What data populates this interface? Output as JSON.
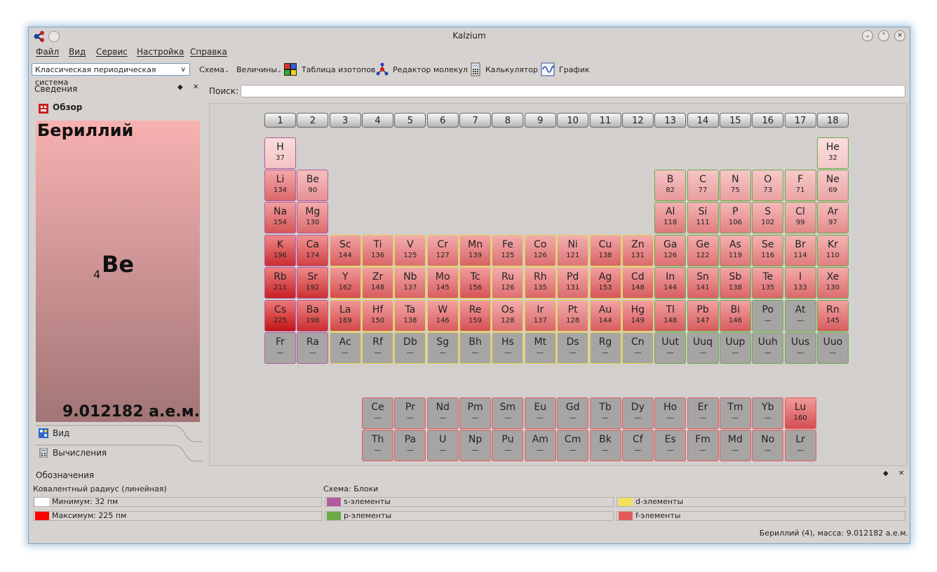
{
  "window": {
    "title": "Kalzium"
  },
  "menu": [
    "Файл",
    "Вид",
    "Сервис",
    "Настройка",
    "Справка"
  ],
  "toolbar": {
    "scheme_select": "Классическая периодическая система",
    "scheme": "Схема",
    "values": "Величины",
    "isotopes": "Таблица изотопов",
    "molecule_editor": "Редактор молекул",
    "calculator": "Калькулятор",
    "plot": "График"
  },
  "info_panel": {
    "title": "Сведения",
    "overview": "Обзор",
    "element_name": "Бериллий",
    "element_number": "4",
    "element_symbol": "Be",
    "element_mass": "9.012182 а.е.м.",
    "tabs": [
      "Вид",
      "Вычисления"
    ]
  },
  "search": {
    "label": "Поиск:",
    "value": ""
  },
  "groups": [
    "1",
    "2",
    "3",
    "4",
    "5",
    "6",
    "7",
    "8",
    "9",
    "10",
    "11",
    "12",
    "13",
    "14",
    "15",
    "16",
    "17",
    "18"
  ],
  "elements": [
    {
      "s": "H",
      "r": "37",
      "row": 0,
      "col": 0,
      "b": "s"
    },
    {
      "s": "He",
      "r": "32",
      "row": 0,
      "col": 17,
      "b": "p"
    },
    {
      "s": "Li",
      "r": "134",
      "row": 1,
      "col": 0,
      "b": "s"
    },
    {
      "s": "Be",
      "r": "90",
      "row": 1,
      "col": 1,
      "b": "s"
    },
    {
      "s": "B",
      "r": "82",
      "row": 1,
      "col": 12,
      "b": "p"
    },
    {
      "s": "C",
      "r": "77",
      "row": 1,
      "col": 13,
      "b": "p"
    },
    {
      "s": "N",
      "r": "75",
      "row": 1,
      "col": 14,
      "b": "p"
    },
    {
      "s": "O",
      "r": "73",
      "row": 1,
      "col": 15,
      "b": "p"
    },
    {
      "s": "F",
      "r": "71",
      "row": 1,
      "col": 16,
      "b": "p"
    },
    {
      "s": "Ne",
      "r": "69",
      "row": 1,
      "col": 17,
      "b": "p"
    },
    {
      "s": "Na",
      "r": "154",
      "row": 2,
      "col": 0,
      "b": "s"
    },
    {
      "s": "Mg",
      "r": "130",
      "row": 2,
      "col": 1,
      "b": "s"
    },
    {
      "s": "Al",
      "r": "118",
      "row": 2,
      "col": 12,
      "b": "p"
    },
    {
      "s": "Si",
      "r": "111",
      "row": 2,
      "col": 13,
      "b": "p"
    },
    {
      "s": "P",
      "r": "106",
      "row": 2,
      "col": 14,
      "b": "p"
    },
    {
      "s": "S",
      "r": "102",
      "row": 2,
      "col": 15,
      "b": "p"
    },
    {
      "s": "Cl",
      "r": "99",
      "row": 2,
      "col": 16,
      "b": "p"
    },
    {
      "s": "Ar",
      "r": "97",
      "row": 2,
      "col": 17,
      "b": "p"
    },
    {
      "s": "K",
      "r": "196",
      "row": 3,
      "col": 0,
      "b": "s"
    },
    {
      "s": "Ca",
      "r": "174",
      "row": 3,
      "col": 1,
      "b": "s"
    },
    {
      "s": "Sc",
      "r": "144",
      "row": 3,
      "col": 2,
      "b": "d"
    },
    {
      "s": "Ti",
      "r": "136",
      "row": 3,
      "col": 3,
      "b": "d"
    },
    {
      "s": "V",
      "r": "125",
      "row": 3,
      "col": 4,
      "b": "d"
    },
    {
      "s": "Cr",
      "r": "127",
      "row": 3,
      "col": 5,
      "b": "d"
    },
    {
      "s": "Mn",
      "r": "139",
      "row": 3,
      "col": 6,
      "b": "d"
    },
    {
      "s": "Fe",
      "r": "125",
      "row": 3,
      "col": 7,
      "b": "d"
    },
    {
      "s": "Co",
      "r": "126",
      "row": 3,
      "col": 8,
      "b": "d"
    },
    {
      "s": "Ni",
      "r": "121",
      "row": 3,
      "col": 9,
      "b": "d"
    },
    {
      "s": "Cu",
      "r": "138",
      "row": 3,
      "col": 10,
      "b": "d"
    },
    {
      "s": "Zn",
      "r": "131",
      "row": 3,
      "col": 11,
      "b": "d"
    },
    {
      "s": "Ga",
      "r": "126",
      "row": 3,
      "col": 12,
      "b": "p"
    },
    {
      "s": "Ge",
      "r": "122",
      "row": 3,
      "col": 13,
      "b": "p"
    },
    {
      "s": "As",
      "r": "119",
      "row": 3,
      "col": 14,
      "b": "p"
    },
    {
      "s": "Se",
      "r": "116",
      "row": 3,
      "col": 15,
      "b": "p"
    },
    {
      "s": "Br",
      "r": "114",
      "row": 3,
      "col": 16,
      "b": "p"
    },
    {
      "s": "Kr",
      "r": "110",
      "row": 3,
      "col": 17,
      "b": "p"
    },
    {
      "s": "Rb",
      "r": "211",
      "row": 4,
      "col": 0,
      "b": "s"
    },
    {
      "s": "Sr",
      "r": "192",
      "row": 4,
      "col": 1,
      "b": "s"
    },
    {
      "s": "Y",
      "r": "162",
      "row": 4,
      "col": 2,
      "b": "d"
    },
    {
      "s": "Zr",
      "r": "148",
      "row": 4,
      "col": 3,
      "b": "d"
    },
    {
      "s": "Nb",
      "r": "137",
      "row": 4,
      "col": 4,
      "b": "d"
    },
    {
      "s": "Mo",
      "r": "145",
      "row": 4,
      "col": 5,
      "b": "d"
    },
    {
      "s": "Tc",
      "r": "156",
      "row": 4,
      "col": 6,
      "b": "d"
    },
    {
      "s": "Ru",
      "r": "126",
      "row": 4,
      "col": 7,
      "b": "d"
    },
    {
      "s": "Rh",
      "r": "135",
      "row": 4,
      "col": 8,
      "b": "d"
    },
    {
      "s": "Pd",
      "r": "131",
      "row": 4,
      "col": 9,
      "b": "d"
    },
    {
      "s": "Ag",
      "r": "153",
      "row": 4,
      "col": 10,
      "b": "d"
    },
    {
      "s": "Cd",
      "r": "148",
      "row": 4,
      "col": 11,
      "b": "d"
    },
    {
      "s": "In",
      "r": "144",
      "row": 4,
      "col": 12,
      "b": "p"
    },
    {
      "s": "Sn",
      "r": "141",
      "row": 4,
      "col": 13,
      "b": "p"
    },
    {
      "s": "Sb",
      "r": "138",
      "row": 4,
      "col": 14,
      "b": "p"
    },
    {
      "s": "Te",
      "r": "135",
      "row": 4,
      "col": 15,
      "b": "p"
    },
    {
      "s": "I",
      "r": "133",
      "row": 4,
      "col": 16,
      "b": "p"
    },
    {
      "s": "Xe",
      "r": "130",
      "row": 4,
      "col": 17,
      "b": "p"
    },
    {
      "s": "Cs",
      "r": "225",
      "row": 5,
      "col": 0,
      "b": "s"
    },
    {
      "s": "Ba",
      "r": "198",
      "row": 5,
      "col": 1,
      "b": "s"
    },
    {
      "s": "La",
      "r": "169",
      "row": 5,
      "col": 2,
      "b": "d"
    },
    {
      "s": "Hf",
      "r": "150",
      "row": 5,
      "col": 3,
      "b": "d"
    },
    {
      "s": "Ta",
      "r": "138",
      "row": 5,
      "col": 4,
      "b": "d"
    },
    {
      "s": "W",
      "r": "146",
      "row": 5,
      "col": 5,
      "b": "d"
    },
    {
      "s": "Re",
      "r": "159",
      "row": 5,
      "col": 6,
      "b": "d"
    },
    {
      "s": "Os",
      "r": "128",
      "row": 5,
      "col": 7,
      "b": "d"
    },
    {
      "s": "Ir",
      "r": "137",
      "row": 5,
      "col": 8,
      "b": "d"
    },
    {
      "s": "Pt",
      "r": "128",
      "row": 5,
      "col": 9,
      "b": "d"
    },
    {
      "s": "Au",
      "r": "144",
      "row": 5,
      "col": 10,
      "b": "d"
    },
    {
      "s": "Hg",
      "r": "149",
      "row": 5,
      "col": 11,
      "b": "d"
    },
    {
      "s": "Tl",
      "r": "148",
      "row": 5,
      "col": 12,
      "b": "p"
    },
    {
      "s": "Pb",
      "r": "147",
      "row": 5,
      "col": 13,
      "b": "p"
    },
    {
      "s": "Bi",
      "r": "146",
      "row": 5,
      "col": 14,
      "b": "p"
    },
    {
      "s": "Po",
      "r": "—",
      "row": 5,
      "col": 15,
      "b": "p"
    },
    {
      "s": "At",
      "r": "—",
      "row": 5,
      "col": 16,
      "b": "p"
    },
    {
      "s": "Rn",
      "r": "145",
      "row": 5,
      "col": 17,
      "b": "p"
    },
    {
      "s": "Fr",
      "r": "—",
      "row": 6,
      "col": 0,
      "b": "s"
    },
    {
      "s": "Ra",
      "r": "—",
      "row": 6,
      "col": 1,
      "b": "s"
    },
    {
      "s": "Ac",
      "r": "—",
      "row": 6,
      "col": 2,
      "b": "d"
    },
    {
      "s": "Rf",
      "r": "—",
      "row": 6,
      "col": 3,
      "b": "d"
    },
    {
      "s": "Db",
      "r": "—",
      "row": 6,
      "col": 4,
      "b": "d"
    },
    {
      "s": "Sg",
      "r": "—",
      "row": 6,
      "col": 5,
      "b": "d"
    },
    {
      "s": "Bh",
      "r": "—",
      "row": 6,
      "col": 6,
      "b": "d"
    },
    {
      "s": "Hs",
      "r": "—",
      "row": 6,
      "col": 7,
      "b": "d"
    },
    {
      "s": "Mt",
      "r": "—",
      "row": 6,
      "col": 8,
      "b": "d"
    },
    {
      "s": "Ds",
      "r": "—",
      "row": 6,
      "col": 9,
      "b": "d"
    },
    {
      "s": "Rg",
      "r": "—",
      "row": 6,
      "col": 10,
      "b": "d"
    },
    {
      "s": "Cn",
      "r": "—",
      "row": 6,
      "col": 11,
      "b": "d"
    },
    {
      "s": "Uut",
      "r": "—",
      "row": 6,
      "col": 12,
      "b": "p"
    },
    {
      "s": "Uuq",
      "r": "—",
      "row": 6,
      "col": 13,
      "b": "p"
    },
    {
      "s": "Uup",
      "r": "—",
      "row": 6,
      "col": 14,
      "b": "p"
    },
    {
      "s": "Uuh",
      "r": "—",
      "row": 6,
      "col": 15,
      "b": "p"
    },
    {
      "s": "Uus",
      "r": "—",
      "row": 6,
      "col": 16,
      "b": "p"
    },
    {
      "s": "Uuo",
      "r": "—",
      "row": 6,
      "col": 17,
      "b": "p"
    },
    {
      "s": "Ce",
      "r": "—",
      "row": 8,
      "col": 3,
      "b": "f"
    },
    {
      "s": "Pr",
      "r": "—",
      "row": 8,
      "col": 4,
      "b": "f"
    },
    {
      "s": "Nd",
      "r": "—",
      "row": 8,
      "col": 5,
      "b": "f"
    },
    {
      "s": "Pm",
      "r": "—",
      "row": 8,
      "col": 6,
      "b": "f"
    },
    {
      "s": "Sm",
      "r": "—",
      "row": 8,
      "col": 7,
      "b": "f"
    },
    {
      "s": "Eu",
      "r": "—",
      "row": 8,
      "col": 8,
      "b": "f"
    },
    {
      "s": "Gd",
      "r": "—",
      "row": 8,
      "col": 9,
      "b": "f"
    },
    {
      "s": "Tb",
      "r": "—",
      "row": 8,
      "col": 10,
      "b": "f"
    },
    {
      "s": "Dy",
      "r": "—",
      "row": 8,
      "col": 11,
      "b": "f"
    },
    {
      "s": "Ho",
      "r": "—",
      "row": 8,
      "col": 12,
      "b": "f"
    },
    {
      "s": "Er",
      "r": "—",
      "row": 8,
      "col": 13,
      "b": "f"
    },
    {
      "s": "Tm",
      "r": "—",
      "row": 8,
      "col": 14,
      "b": "f"
    },
    {
      "s": "Yb",
      "r": "—",
      "row": 8,
      "col": 15,
      "b": "f"
    },
    {
      "s": "Lu",
      "r": "160",
      "row": 8,
      "col": 16,
      "b": "f"
    },
    {
      "s": "Th",
      "r": "—",
      "row": 9,
      "col": 3,
      "b": "f"
    },
    {
      "s": "Pa",
      "r": "—",
      "row": 9,
      "col": 4,
      "b": "f"
    },
    {
      "s": "U",
      "r": "—",
      "row": 9,
      "col": 5,
      "b": "f"
    },
    {
      "s": "Np",
      "r": "—",
      "row": 9,
      "col": 6,
      "b": "f"
    },
    {
      "s": "Pu",
      "r": "—",
      "row": 9,
      "col": 7,
      "b": "f"
    },
    {
      "s": "Am",
      "r": "—",
      "row": 9,
      "col": 8,
      "b": "f"
    },
    {
      "s": "Cm",
      "r": "—",
      "row": 9,
      "col": 9,
      "b": "f"
    },
    {
      "s": "Bk",
      "r": "—",
      "row": 9,
      "col": 10,
      "b": "f"
    },
    {
      "s": "Cf",
      "r": "—",
      "row": 9,
      "col": 11,
      "b": "f"
    },
    {
      "s": "Es",
      "r": "—",
      "row": 9,
      "col": 12,
      "b": "f"
    },
    {
      "s": "Fm",
      "r": "—",
      "row": 9,
      "col": 13,
      "b": "f"
    },
    {
      "s": "Md",
      "r": "—",
      "row": 9,
      "col": 14,
      "b": "f"
    },
    {
      "s": "No",
      "r": "—",
      "row": 9,
      "col": 15,
      "b": "f"
    },
    {
      "s": "Lr",
      "r": "—",
      "row": 9,
      "col": 16,
      "b": "f"
    }
  ],
  "legend": {
    "title": "Обозначения",
    "gradient_title": "Ковалентный радиус (линейная)",
    "min": "Минимум: 32 пм",
    "max": "Максимум: 225 пм",
    "scheme_title": "Схема: Блоки",
    "s_block": "s-элементы",
    "p_block": "p-элементы",
    "d_block": "d-элементы",
    "f_block": "f-элементы",
    "colors": {
      "min": "#ffffff",
      "max": "#ff0000",
      "s": "#b35b9e",
      "p": "#6aab46",
      "d": "#f2e05a",
      "f": "#e35a5a"
    }
  },
  "status": "Бериллий (4), масса: 9.012182 а.е.м."
}
